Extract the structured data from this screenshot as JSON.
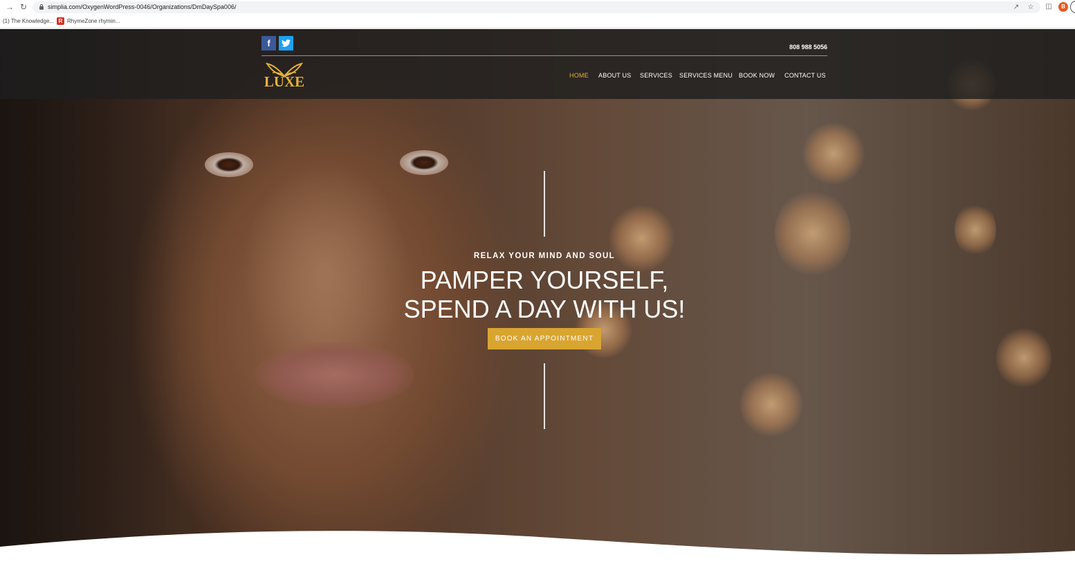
{
  "browser": {
    "url": "simplia.com/OxygenWordPress-0046/Organizations/DmDaySpa006/",
    "profile_initial": "B",
    "bookmarks": [
      {
        "label": "(1) The Knowledge..."
      },
      {
        "label": "RhymeZone rhymin..."
      }
    ]
  },
  "header": {
    "phone": "808 988 5056",
    "logo_text": "LUXE",
    "social": [
      "facebook-icon",
      "twitter-icon"
    ],
    "nav": [
      {
        "label": "HOME",
        "active": true
      },
      {
        "label": "ABOUT US"
      },
      {
        "label": "SERVICES"
      },
      {
        "label": "SERVICES MENU"
      },
      {
        "label": "BOOK NOW"
      },
      {
        "label": "CONTACT US"
      }
    ]
  },
  "hero": {
    "kicker": "RELAX YOUR MIND AND SOUL",
    "title_line1": "PAMPER YOURSELF,",
    "title_line2": "SPEND A DAY WITH US!",
    "cta_label": "BOOK AN APPOINTMENT"
  },
  "colors": {
    "accent_gold": "#e4b23c",
    "button_gold": "#d9a531",
    "header_bg": "#1e1e1e",
    "facebook_blue": "#3b5998",
    "twitter_blue": "#1da1f2"
  }
}
